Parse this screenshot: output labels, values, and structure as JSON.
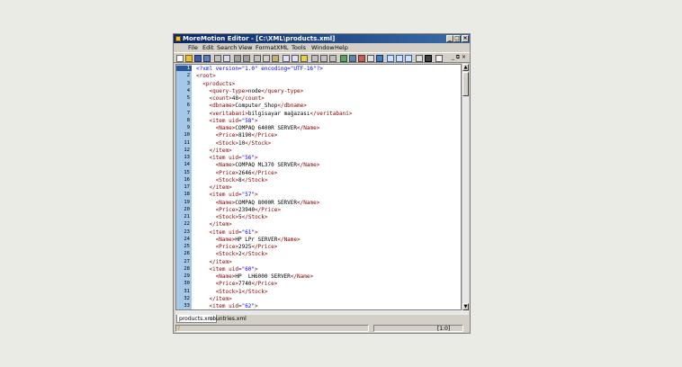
{
  "window": {
    "title": "MoreMotion Editor - [C:\\XML\\products.xml]",
    "min_glyph": "_",
    "max_glyph": "□",
    "close_glyph": "×"
  },
  "menu": [
    {
      "key": "file",
      "label": "File"
    },
    {
      "key": "edit",
      "label": "Edit"
    },
    {
      "key": "search",
      "label": "Search"
    },
    {
      "key": "view",
      "label": "View"
    },
    {
      "key": "format",
      "label": "Format"
    },
    {
      "key": "xml",
      "label": "XML"
    },
    {
      "key": "tools",
      "label": "Tools"
    },
    {
      "key": "window",
      "label": "Window"
    },
    {
      "key": "help",
      "label": "Help"
    }
  ],
  "mdi_controls": "_ ⧉ ×",
  "editor": {
    "lines": [
      {
        "n": "1",
        "t": "<?xml version=\"1.0\" encoding=\"UTF-16\"?>"
      },
      {
        "n": "2",
        "t": "<root>"
      },
      {
        "n": "3",
        "t": "  <products>"
      },
      {
        "n": "4",
        "t": "    <query-type>node</query-type>"
      },
      {
        "n": "5",
        "t": "    <count>48</count>"
      },
      {
        "n": "6",
        "t": "    <dbname>Computer_Shop</dbname>"
      },
      {
        "n": "7",
        "t": "    <veritabani>bilgisayar mağazası</veritabani>"
      },
      {
        "n": "8",
        "t": "    <item uid=\"58\">"
      },
      {
        "n": "9",
        "t": "      <Name>COMPAQ 6400R SERVER</Name>"
      },
      {
        "n": "10",
        "t": "      <Price>8190</Price>"
      },
      {
        "n": "11",
        "t": "      <Stock>10</Stock>"
      },
      {
        "n": "12",
        "t": "    </item>"
      },
      {
        "n": "13",
        "t": "    <item uid=\"56\">"
      },
      {
        "n": "14",
        "t": "      <Name>COMPAQ ML370 SERVER</Name>"
      },
      {
        "n": "15",
        "t": "      <Price>2646</Price>"
      },
      {
        "n": "16",
        "t": "      <Stock>8</Stock>"
      },
      {
        "n": "17",
        "t": "    </item>"
      },
      {
        "n": "18",
        "t": "    <item uid=\"57\">"
      },
      {
        "n": "19",
        "t": "      <Name>COMPAQ 8000R SERVER</Name>"
      },
      {
        "n": "20",
        "t": "      <Price>23940</Price>"
      },
      {
        "n": "21",
        "t": "      <Stock>5</Stock>"
      },
      {
        "n": "22",
        "t": "    </item>"
      },
      {
        "n": "23",
        "t": "    <item uid=\"61\">"
      },
      {
        "n": "24",
        "t": "      <Name>HP LPr SERVER</Name>"
      },
      {
        "n": "25",
        "t": "      <Price>2925</Price>"
      },
      {
        "n": "26",
        "t": "      <Stock>2</Stock>"
      },
      {
        "n": "27",
        "t": "    </item>"
      },
      {
        "n": "28",
        "t": "    <item uid=\"60\">"
      },
      {
        "n": "29",
        "t": "      <Name>HP  LH6000 SERVER</Name>"
      },
      {
        "n": "30",
        "t": "      <Price>7740</Price>"
      },
      {
        "n": "31",
        "t": "      <Stock>1</Stock>"
      },
      {
        "n": "32",
        "t": "    </item>"
      },
      {
        "n": "33",
        "t": "    <item uid=\"62\">"
      }
    ]
  },
  "tabs": [
    {
      "label": "products.xml",
      "active": true
    },
    {
      "label": "countries.xml",
      "active": false
    }
  ],
  "status": {
    "position": "[1:0]"
  },
  "colors": {
    "titlebar": "#0a246a",
    "gutter": "#a6c8e8",
    "tag": "#800000",
    "attr_value": "#0000ff"
  }
}
